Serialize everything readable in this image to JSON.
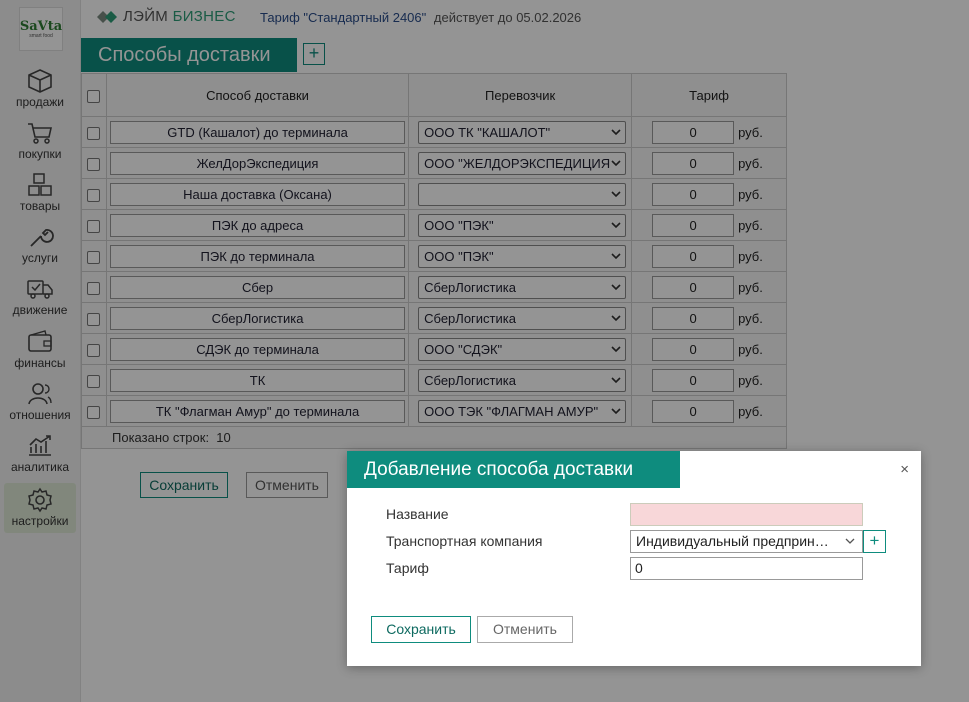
{
  "logo": {
    "text": "SaVta",
    "sub": "smart food"
  },
  "sidebar": {
    "items": [
      {
        "label": "продажи",
        "icon": "box-icon"
      },
      {
        "label": "покупки",
        "icon": "cart-icon"
      },
      {
        "label": "товары",
        "icon": "grid-icon"
      },
      {
        "label": "услуги",
        "icon": "wrench-icon"
      },
      {
        "label": "движение",
        "icon": "truck-icon"
      },
      {
        "label": "финансы",
        "icon": "wallet-icon"
      },
      {
        "label": "отношения",
        "icon": "people-icon"
      },
      {
        "label": "аналитика",
        "icon": "chart-icon"
      },
      {
        "label": "настройки",
        "icon": "gear-icon",
        "active": true
      }
    ]
  },
  "topbar": {
    "brand_left": "ЛЭЙМ",
    "brand_right": "БИЗНЕС",
    "tariff": "Тариф \"Стандартный 2406\"",
    "valid_until": "действует до 05.02.2026"
  },
  "page": {
    "title": "Способы доставки",
    "add_label": "+"
  },
  "table": {
    "headers": {
      "name": "Способ доставки",
      "carrier": "Перевозчик",
      "tariff": "Тариф"
    },
    "rows": [
      {
        "name": "GTD (Кашалот) до терминала",
        "carrier": "ООО ТК \"КАШАЛОТ\"",
        "tariff": "0",
        "unit": "руб."
      },
      {
        "name": "ЖелДорЭкспедиция",
        "carrier": "ООО \"ЖЕЛДОРЭКСПЕДИЦИЯ\"",
        "tariff": "0",
        "unit": "руб."
      },
      {
        "name": "Наша доставка  (Оксана)",
        "carrier": "",
        "tariff": "0",
        "unit": "руб."
      },
      {
        "name": "ПЭК до адреса",
        "carrier": "ООО \"ПЭК\"",
        "tariff": "0",
        "unit": "руб."
      },
      {
        "name": "ПЭК до терминала",
        "carrier": "ООО \"ПЭК\"",
        "tariff": "0",
        "unit": "руб."
      },
      {
        "name": "Сбер",
        "carrier": "СберЛогистика",
        "tariff": "0",
        "unit": "руб."
      },
      {
        "name": "СберЛогистика",
        "carrier": "СберЛогистика",
        "tariff": "0",
        "unit": "руб."
      },
      {
        "name": "СДЭК до терминала",
        "carrier": "ООО \"СДЭК\"",
        "tariff": "0",
        "unit": "руб."
      },
      {
        "name": "ТК",
        "carrier": "СберЛогистика",
        "tariff": "0",
        "unit": "руб."
      },
      {
        "name": "ТК \"Флагман Амур\" до терминала",
        "carrier": "ООО ТЭК \"ФЛАГМАН АМУР\"",
        "tariff": "0",
        "unit": "руб."
      }
    ],
    "rows_shown_label": "Показано строк:",
    "rows_shown_count": "10"
  },
  "actions": {
    "save": "Сохранить",
    "cancel": "Отменить"
  },
  "modal": {
    "title": "Добавление способа доставки",
    "close": "×",
    "name_label": "Название",
    "name_value": "",
    "company_label": "Транспортная компания",
    "company_value": "Индивидуальный предприн…",
    "add_label": "+",
    "tariff_label": "Тариф",
    "tariff_value": "0",
    "save": "Сохранить",
    "cancel": "Отменить"
  },
  "colors": {
    "accent": "#0e8c7e",
    "brand": "#2d9d78",
    "invalid": "#f8d7d9"
  }
}
